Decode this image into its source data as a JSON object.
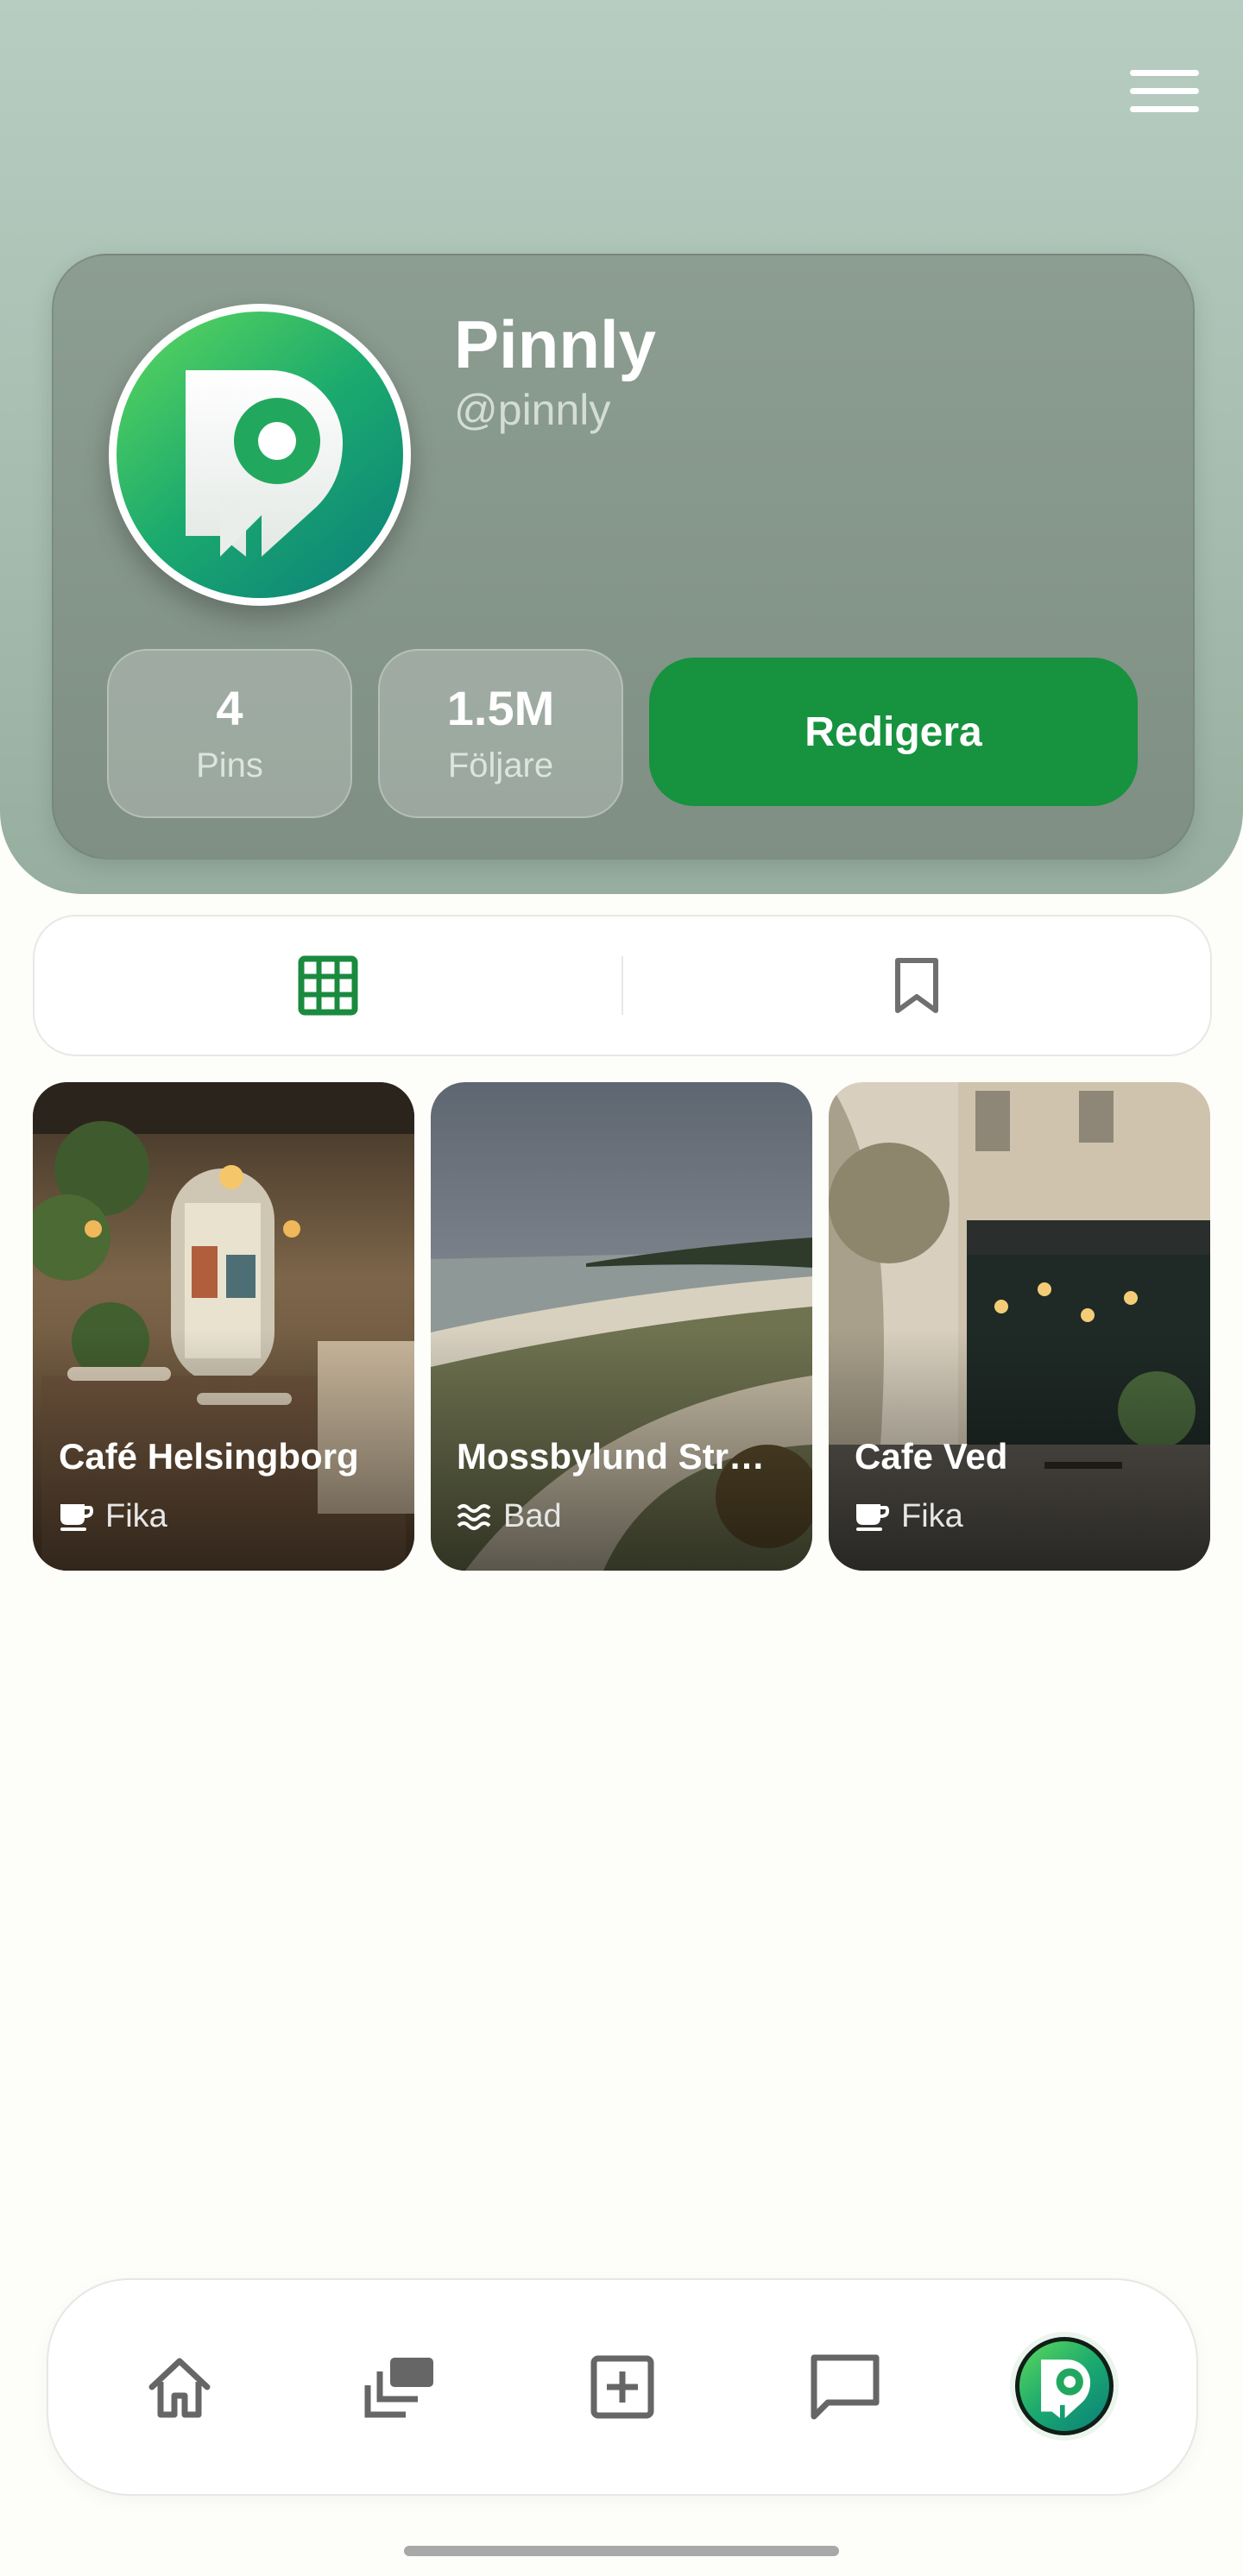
{
  "header": {
    "menu_icon": "hamburger-menu-icon",
    "bg_color": "#A9C0B3"
  },
  "profile": {
    "name": "Pinnly",
    "handle": "@pinnly",
    "logo_letter": "P",
    "logo_colors": [
      "#5FD85C",
      "#1BAA6E",
      "#0B7E7B"
    ],
    "stats": [
      {
        "value": "4",
        "label": "Pins"
      },
      {
        "value": "1.5M",
        "label": "Följare"
      }
    ],
    "edit_label": "Redigera",
    "accent_color": "#17923F"
  },
  "tabs": [
    {
      "name": "grid",
      "icon": "grid-icon",
      "active": true
    },
    {
      "name": "saved",
      "icon": "bookmark-icon",
      "active": false
    }
  ],
  "pins": [
    {
      "name": "Café Helsingborg",
      "category": "Fika",
      "category_icon": "coffee-cup-icon",
      "scene": "cafe interior"
    },
    {
      "name": "Mossbylund Str…",
      "category": "Bad",
      "category_icon": "waves-icon",
      "scene": "beach"
    },
    {
      "name": "Cafe Ved",
      "category": "Fika",
      "category_icon": "coffee-cup-icon",
      "scene": "street cafe"
    }
  ],
  "bottom_nav": [
    {
      "name": "home",
      "icon": "home-icon"
    },
    {
      "name": "feed",
      "icon": "stacked-cards-icon"
    },
    {
      "name": "add",
      "icon": "add-square-icon"
    },
    {
      "name": "messages",
      "icon": "chat-icon"
    },
    {
      "name": "profile",
      "icon": "profile-avatar-icon",
      "active": true
    }
  ]
}
